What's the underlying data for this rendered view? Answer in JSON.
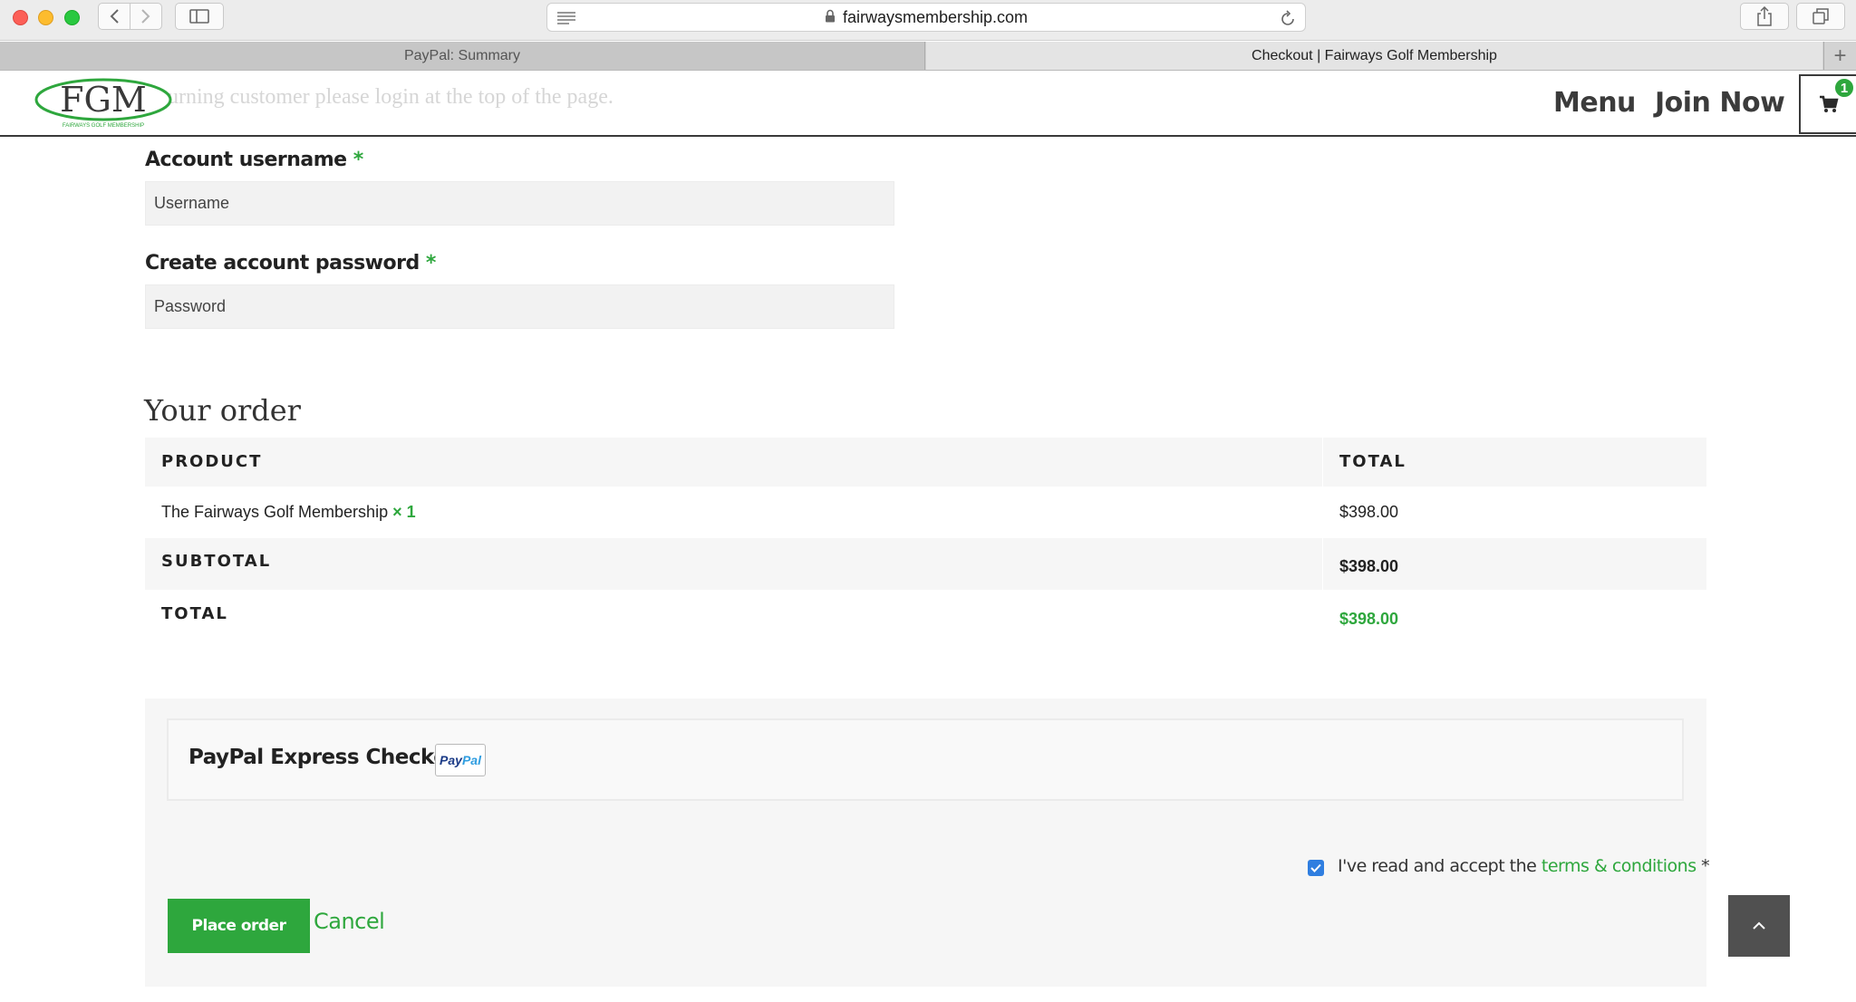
{
  "browser": {
    "url": "fairwaysmembership.com",
    "tabs": [
      {
        "label": "PayPal: Summary",
        "active": false
      },
      {
        "label": "Checkout | Fairways Golf Membership",
        "active": true
      }
    ],
    "new_tab_label": "+"
  },
  "header": {
    "logo_text": "FGM",
    "logo_subtext": "FAIRWAYS GOLF MEMBERSHIP",
    "ghost_notice": "urning customer please login at the top of the page.",
    "nav": {
      "menu": "Menu",
      "join": "Join Now"
    },
    "cart_count": "1"
  },
  "form": {
    "username_label": "Account username",
    "username_placeholder": "Username",
    "password_label": "Create account password",
    "password_placeholder": "Password",
    "required_mark": "*"
  },
  "order": {
    "title": "Your order",
    "col_product": "PRODUCT",
    "col_total": "TOTAL",
    "item_name": "The Fairways Golf Membership",
    "item_qty": "× 1",
    "item_total": "$398.00",
    "subtotal_label": "SUBTOTAL",
    "subtotal_value": "$398.00",
    "total_label": "TOTAL",
    "total_value": "$398.00"
  },
  "payment": {
    "method_label": "PayPal Express Checkout",
    "paypal_mark_a": "Pay",
    "paypal_mark_b": "Pal",
    "terms_prefix": "I've read and accept the ",
    "terms_link": "terms & conditions",
    "terms_suffix": " *",
    "terms_checked": true,
    "place_order": "Place order",
    "cancel": "Cancel"
  },
  "colors": {
    "brand_green": "#2ea73d",
    "checkbox_blue": "#2f7ee0",
    "scroll_button": "#505050"
  },
  "icons": [
    "back-icon",
    "forward-icon",
    "sidebar-icon",
    "reader-icon",
    "lock-icon",
    "reload-icon",
    "share-icon",
    "tabs-icon",
    "cart-icon",
    "chevron-up-icon",
    "checkmark-icon"
  ]
}
